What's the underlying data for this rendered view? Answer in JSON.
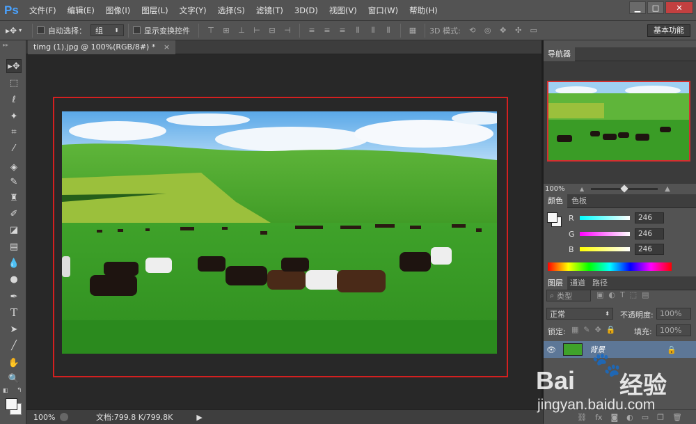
{
  "app": {
    "logo": "Ps"
  },
  "menu": [
    "文件(F)",
    "编辑(E)",
    "图像(I)",
    "图层(L)",
    "文字(Y)",
    "选择(S)",
    "滤镜(T)",
    "3D(D)",
    "视图(V)",
    "窗口(W)",
    "帮助(H)"
  ],
  "options": {
    "auto_select_label": "自动选择：",
    "auto_select_value": "组",
    "transform_label": "显示变换控件",
    "mode_3d_label": "3D 模式:",
    "workspace_label": "基本功能"
  },
  "document": {
    "tab_title": "timg (1).jpg @ 100%(RGB/8#) *",
    "tab_close": "×"
  },
  "status": {
    "zoom": "100%",
    "doc_info": "文档:799.8 K/799.8K",
    "arrow": "▶"
  },
  "navigator": {
    "tab": "导航器",
    "zoom": "100%"
  },
  "color_panel": {
    "tabs": [
      "颜色",
      "色板"
    ],
    "channels": [
      {
        "label": "R",
        "value": "246"
      },
      {
        "label": "G",
        "value": "246"
      },
      {
        "label": "B",
        "value": "246"
      }
    ]
  },
  "layers_panel": {
    "tabs": [
      "图层",
      "通道",
      "路径"
    ],
    "kind_filter": "类型",
    "blend_mode": "正常",
    "opacity_label": "不透明度:",
    "opacity_value": "100%",
    "lock_label": "锁定:",
    "fill_label": "填充:",
    "fill_value": "100%",
    "layer_name": "背景"
  },
  "watermark": {
    "brand": "Bai",
    "brand_cn": "经验",
    "url": "jingyan.baidu.com"
  },
  "colors": {
    "selection_frame": "#d42020",
    "ps_blue": "#4aa3ff"
  }
}
